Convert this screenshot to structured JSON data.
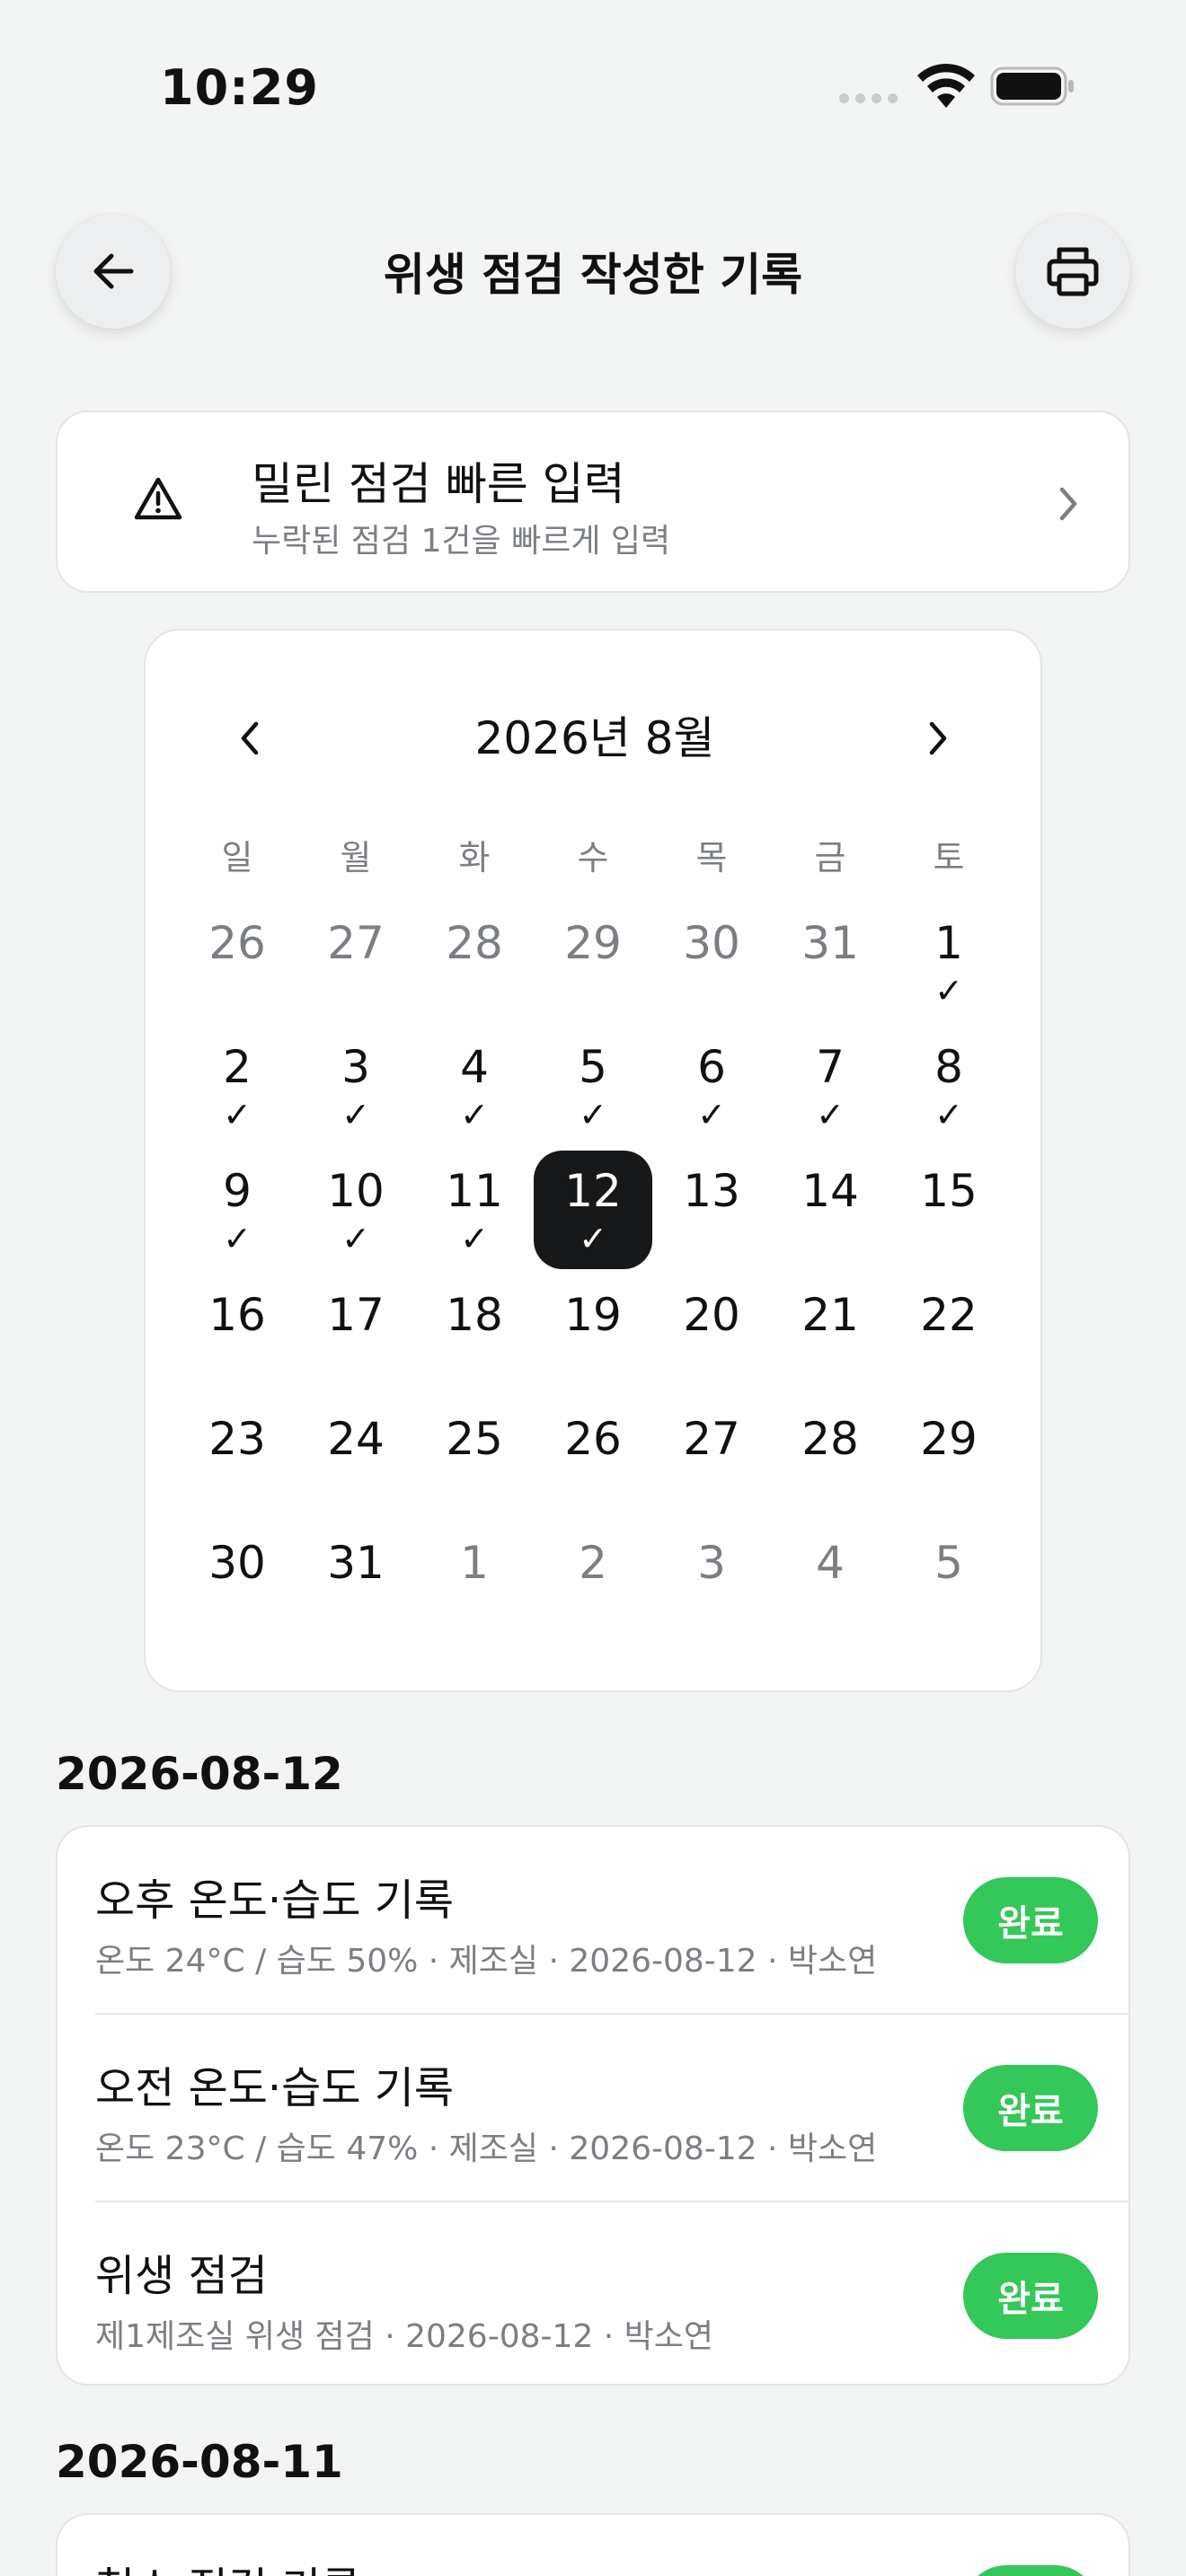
{
  "status_bar": {
    "time": "10:29"
  },
  "header": {
    "title": "위생 점검 작성한 기록"
  },
  "quick_entry": {
    "title": "밀린 점검 빠른 입력",
    "subtitle": "누락된 점검 1건을 빠르게 입력"
  },
  "calendar": {
    "month_label": "2026년 8월",
    "weekdays": [
      "일",
      "월",
      "화",
      "수",
      "목",
      "금",
      "토"
    ],
    "check_mark": "✓",
    "weeks": [
      [
        {
          "d": "26",
          "other": true
        },
        {
          "d": "27",
          "other": true
        },
        {
          "d": "28",
          "other": true
        },
        {
          "d": "29",
          "other": true
        },
        {
          "d": "30",
          "other": true
        },
        {
          "d": "31",
          "other": true
        },
        {
          "d": "1",
          "check": true
        }
      ],
      [
        {
          "d": "2",
          "check": true
        },
        {
          "d": "3",
          "check": true
        },
        {
          "d": "4",
          "check": true
        },
        {
          "d": "5",
          "check": true
        },
        {
          "d": "6",
          "check": true
        },
        {
          "d": "7",
          "check": true
        },
        {
          "d": "8",
          "check": true
        }
      ],
      [
        {
          "d": "9",
          "check": true
        },
        {
          "d": "10",
          "check": true
        },
        {
          "d": "11",
          "check": true
        },
        {
          "d": "12",
          "check": true,
          "selected": true
        },
        {
          "d": "13"
        },
        {
          "d": "14"
        },
        {
          "d": "15"
        }
      ],
      [
        {
          "d": "16"
        },
        {
          "d": "17"
        },
        {
          "d": "18"
        },
        {
          "d": "19"
        },
        {
          "d": "20"
        },
        {
          "d": "21"
        },
        {
          "d": "22"
        }
      ],
      [
        {
          "d": "23"
        },
        {
          "d": "24"
        },
        {
          "d": "25"
        },
        {
          "d": "26"
        },
        {
          "d": "27"
        },
        {
          "d": "28"
        },
        {
          "d": "29"
        }
      ],
      [
        {
          "d": "30"
        },
        {
          "d": "31"
        },
        {
          "d": "1",
          "other": true
        },
        {
          "d": "2",
          "other": true
        },
        {
          "d": "3",
          "other": true
        },
        {
          "d": "4",
          "other": true
        },
        {
          "d": "5",
          "other": true
        }
      ]
    ]
  },
  "records": [
    {
      "date": "2026-08-12",
      "items": [
        {
          "title": "오후 온도·습도 기록",
          "subtitle": "온도 24°C / 습도 50% · 제조실 · 2026-08-12 · 박소연",
          "status": "완료"
        },
        {
          "title": "오전 온도·습도 기록",
          "subtitle": "온도 23°C / 습도 47% · 제조실 · 2026-08-12 · 박소연",
          "status": "완료"
        },
        {
          "title": "위생 점검",
          "subtitle": "제1제조실 위생 점검 · 2026-08-12 · 박소연",
          "status": "완료"
        }
      ]
    },
    {
      "date": "2026-08-11",
      "items": [
        {
          "title": "청소 점검 기록",
          "subtitle": "",
          "status": "완료"
        }
      ]
    }
  ],
  "colors": {
    "badge_green": "#34c759",
    "selected_day": "#171819",
    "background": "#f3f4f4"
  },
  "icons": [
    "back-arrow-icon",
    "printer-icon",
    "warning-triangle-icon",
    "chevron-right-icon",
    "chevron-left-icon",
    "wifi-icon",
    "battery-icon",
    "cellular-signal-icon"
  ]
}
